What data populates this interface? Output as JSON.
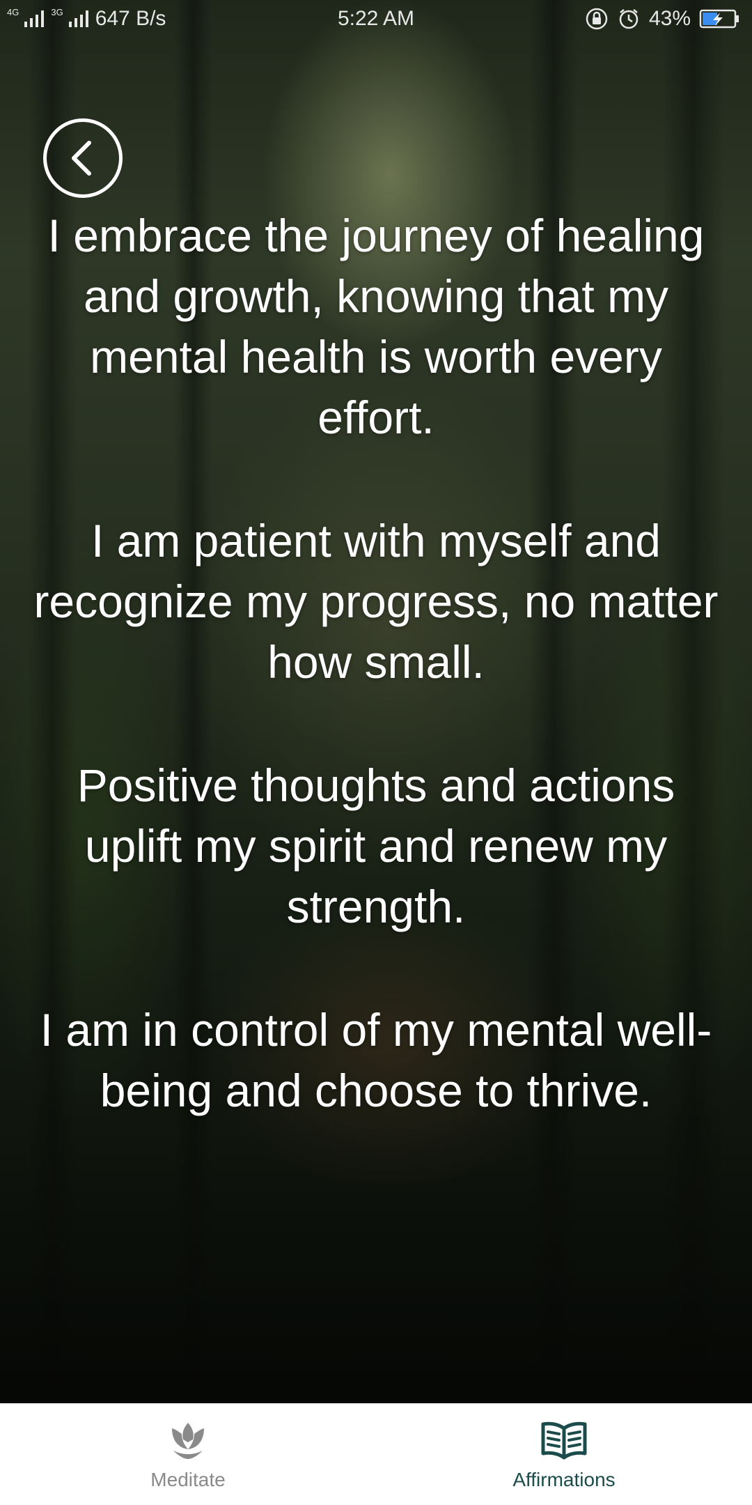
{
  "status_bar": {
    "network_small": "4G",
    "network_small_2": "3G",
    "speed": "647 B/s",
    "time": "5:22 AM",
    "battery": "43%"
  },
  "back_button": {
    "icon": "chevron-left-icon"
  },
  "affirmations": [
    "I embrace the journey of healing and growth, knowing that my mental health is worth every effort.",
    "I am patient with myself and recognize my progress, no matter how small.",
    "Positive thoughts and actions uplift my spirit and renew my strength.",
    "I am in control of my mental well-being and choose to thrive."
  ],
  "bottom_nav": {
    "items": [
      {
        "label": "Meditate",
        "icon": "lotus-icon",
        "active": false
      },
      {
        "label": "Affirmations",
        "icon": "open-book-icon",
        "active": true
      }
    ]
  },
  "colors": {
    "active_tab": "#1b4b4a",
    "inactive_tab": "#8a8a8a",
    "text": "#ffffff"
  }
}
